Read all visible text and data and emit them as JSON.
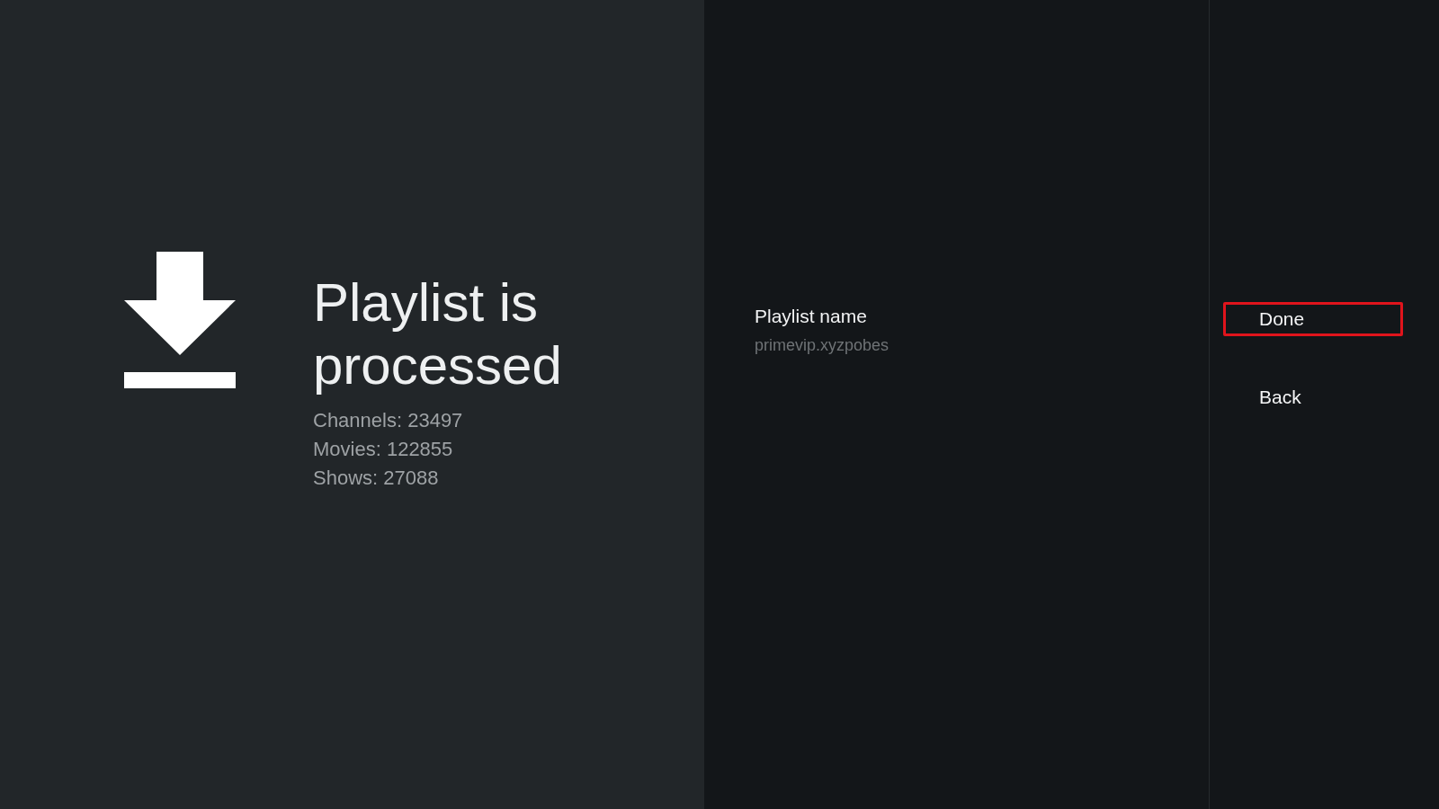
{
  "summary": {
    "title": "Playlist is processed",
    "stats": [
      "Channels: 23497",
      "Movies: 122855",
      "Shows: 27088"
    ]
  },
  "details": {
    "label": "Playlist name",
    "value": "primevip.xyzpobes"
  },
  "actions": [
    {
      "label": "Done",
      "selected": true
    },
    {
      "label": "Back",
      "selected": false
    }
  ]
}
